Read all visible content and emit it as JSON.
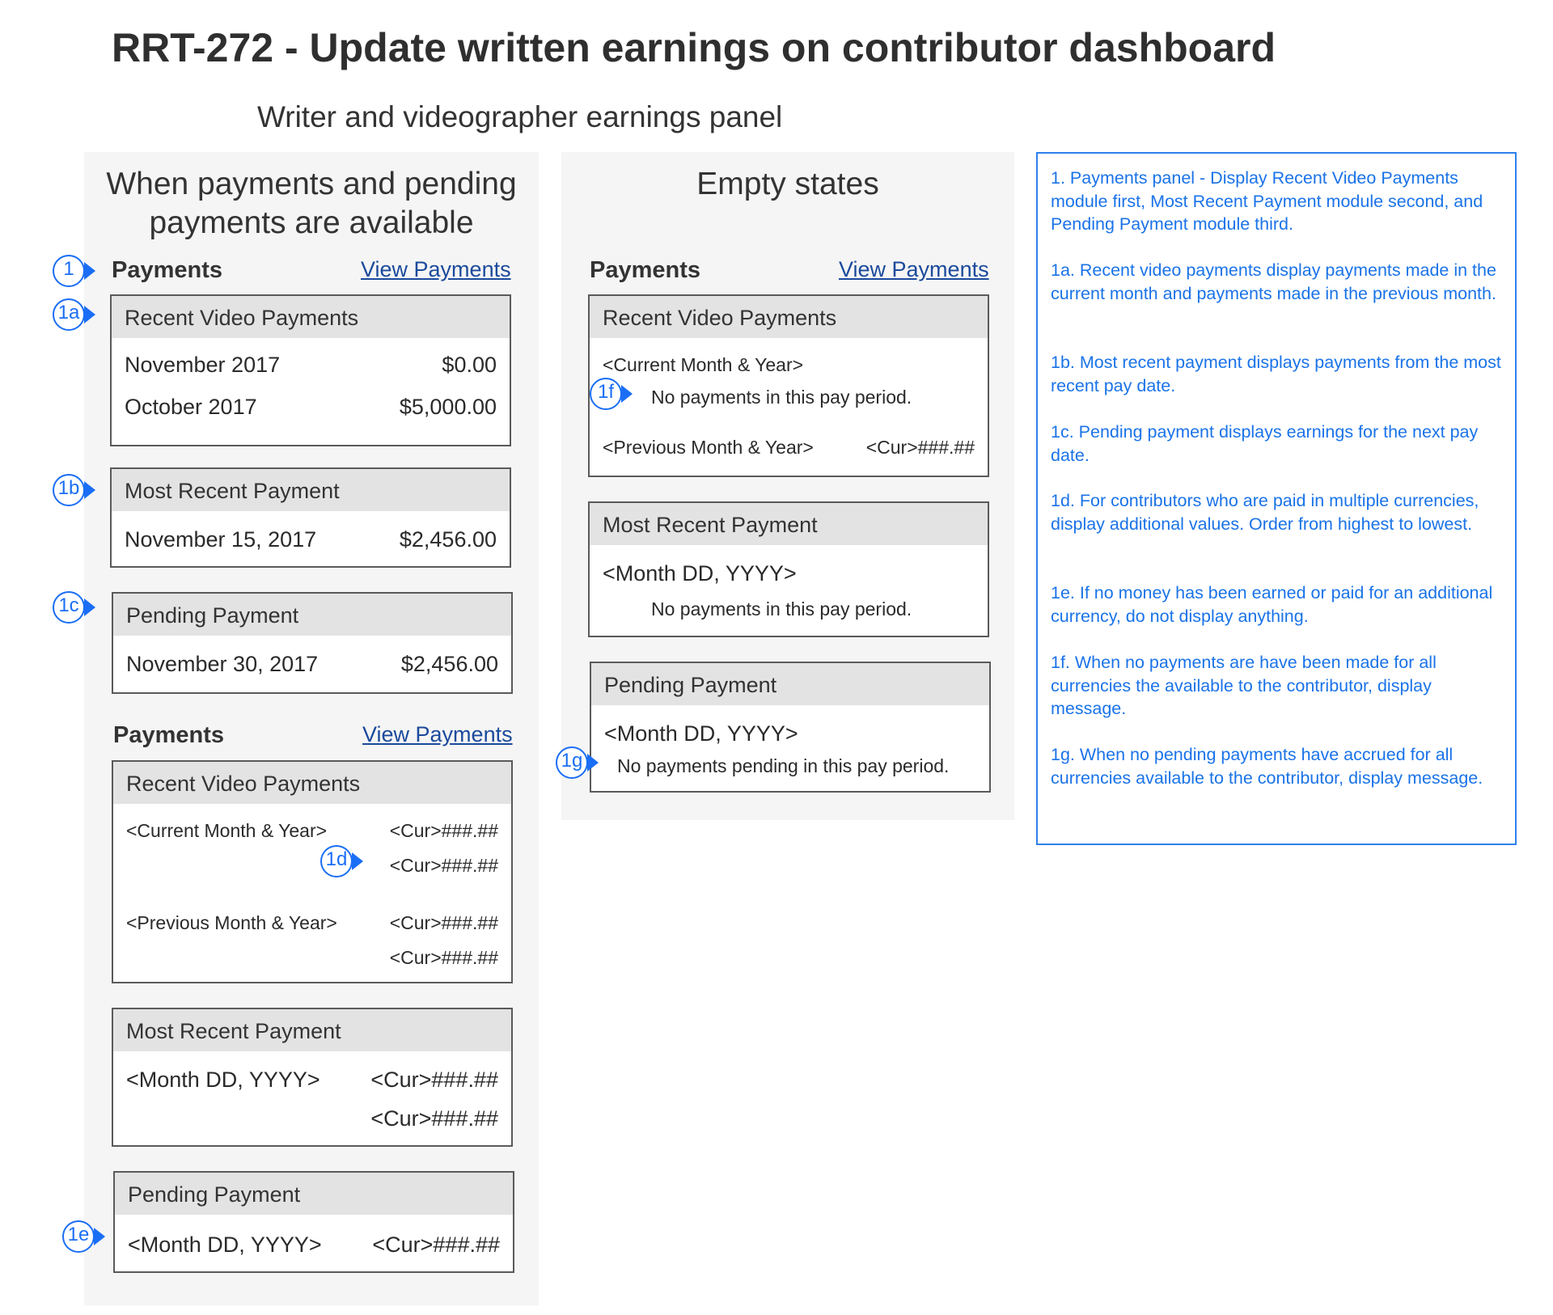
{
  "title": "RRT-272 - Update written earnings on contributor dashboard",
  "subtitle": "Writer and videographer earnings panel",
  "left_column": {
    "heading_line1": "When payments and pending",
    "heading_line2": "payments are available",
    "panel1": {
      "payments_label": "Payments",
      "view_link": "View Payments",
      "recent": {
        "header": "Recent Video Payments",
        "rows": [
          {
            "label": "November 2017",
            "value": "$0.00"
          },
          {
            "label": "October 2017",
            "value": "$5,000.00"
          }
        ]
      },
      "most_recent": {
        "header": "Most Recent Payment",
        "label": "November 15, 2017",
        "value": "$2,456.00"
      },
      "pending": {
        "header": "Pending Payment",
        "label": "November 30, 2017",
        "value": "$2,456.00"
      }
    },
    "panel2": {
      "payments_label": "Payments",
      "view_link": "View Payments",
      "recent": {
        "header": "Recent Video Payments",
        "current_label": "<Current Month & Year>",
        "current_values": [
          "<Cur>###.##",
          "<Cur>###.##"
        ],
        "previous_label": "<Previous Month & Year>",
        "previous_values": [
          "<Cur>###.##",
          "<Cur>###.##"
        ]
      },
      "most_recent": {
        "header": "Most Recent Payment",
        "label": "<Month DD, YYYY>",
        "values": [
          "<Cur>###.##",
          "<Cur>###.##"
        ]
      },
      "pending": {
        "header": "Pending Payment",
        "label": "<Month DD, YYYY>",
        "value": "<Cur>###.##"
      }
    }
  },
  "empty_column": {
    "heading": "Empty states",
    "payments_label": "Payments",
    "view_link": "View Payments",
    "recent": {
      "header": "Recent Video Payments",
      "current_label": "<Current Month & Year>",
      "no_payments": "No payments in this pay period.",
      "previous_label": "<Previous Month & Year>",
      "previous_value": "<Cur>###.##"
    },
    "most_recent": {
      "header": "Most Recent Payment",
      "label": "<Month DD, YYYY>",
      "no_payments": "No payments in this pay period."
    },
    "pending": {
      "header": "Pending Payment",
      "label": "<Month DD, YYYY>",
      "no_payments": "No payments pending in this pay period."
    }
  },
  "badges": {
    "b1": "1",
    "b1a": "1a",
    "b1b": "1b",
    "b1c": "1c",
    "b1d": "1d",
    "b1e": "1e",
    "b1f": "1f",
    "b1g": "1g"
  },
  "notes": [
    "1. Payments panel - Display Recent Video Payments module first, Most Recent Payment module second, and Pending Payment module third.",
    "1a. Recent video payments display payments made in the current month and payments made in the previous month.",
    "1b. Most recent payment displays payments from the most recent pay date.",
    "1c. Pending payment displays earnings for the next pay date.",
    "1d. For contributors who are paid in multiple currencies, display additional values. Order from highest to lowest.",
    "1e. If no money has been earned or paid for an additional currency, do not display anything.",
    "1f. When no payments are have been made for all currencies the available to the contributor, display message.",
    "1g. When no pending payments have accrued for all currencies available to the contributor, display message."
  ],
  "colors": {
    "annotation_blue": "#1a73e8",
    "panel_bg": "#f5f5f5",
    "card_header_bg": "#e3e3e3",
    "link": "#1b4a9c"
  }
}
